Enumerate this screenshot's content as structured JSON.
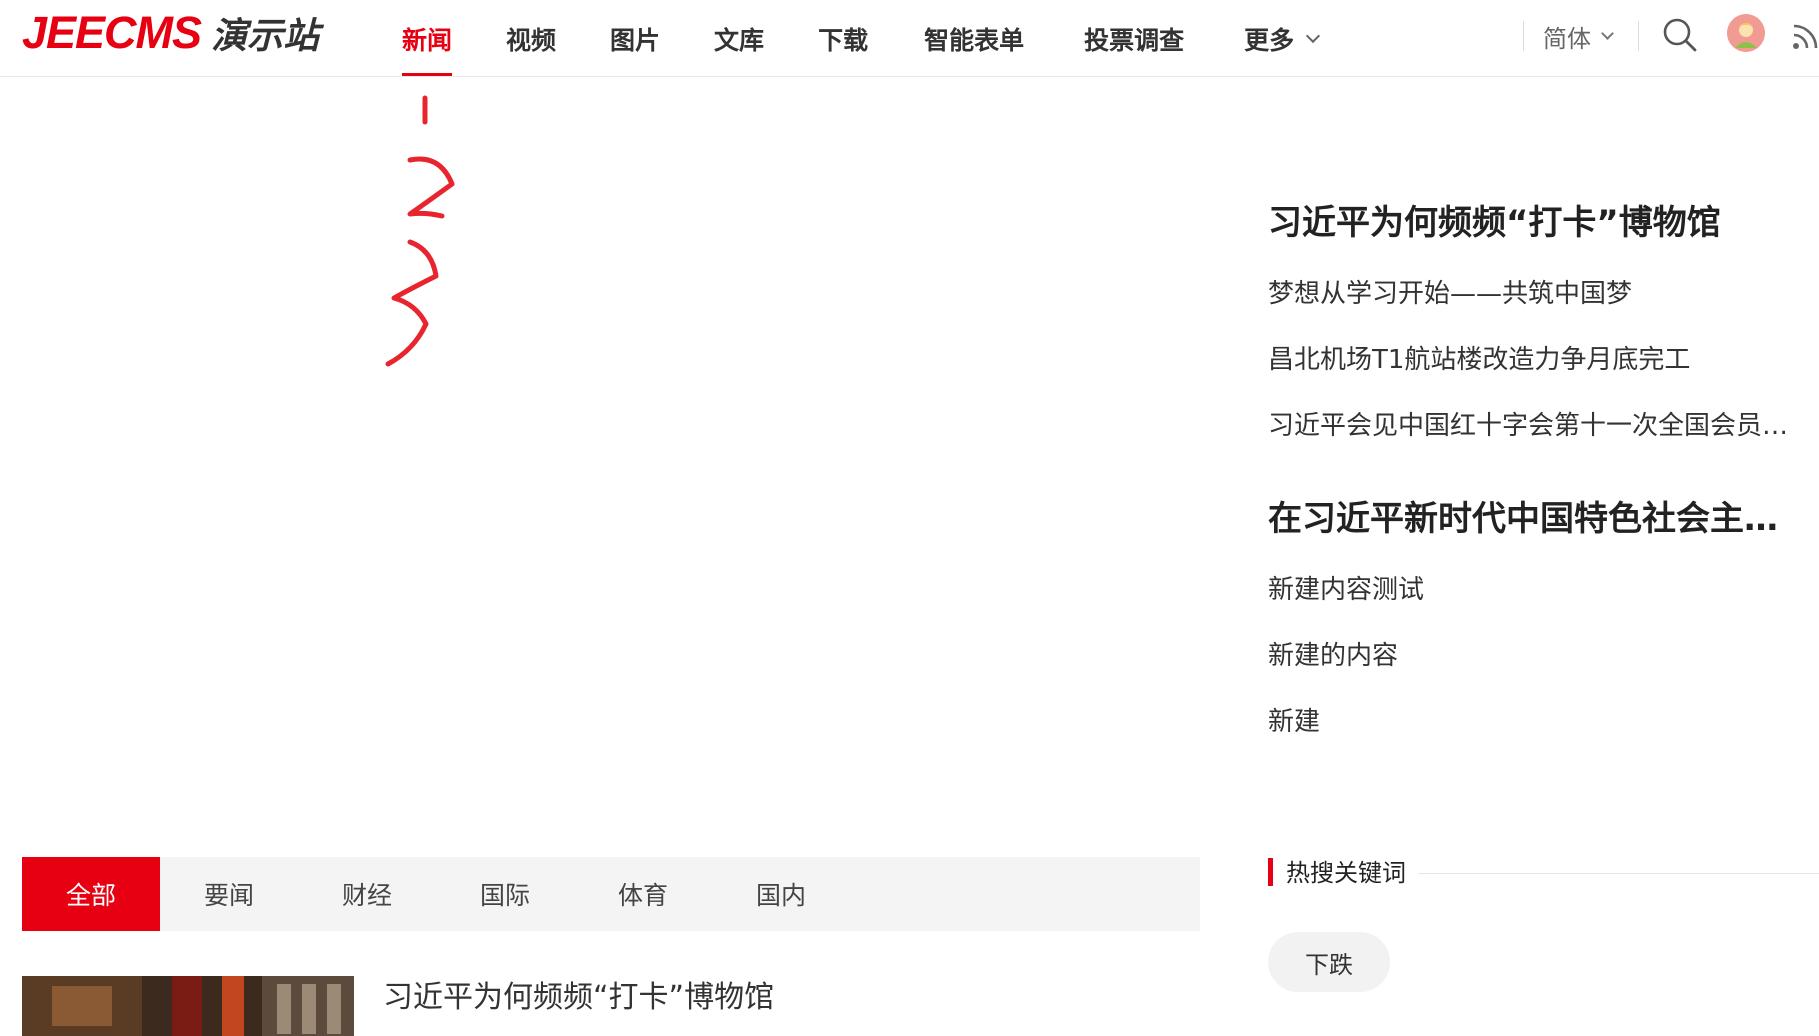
{
  "header": {
    "logo_brand": "JEECMS",
    "logo_sub": "演示站",
    "nav": [
      {
        "label": "新闻",
        "active": true
      },
      {
        "label": "视频",
        "active": false
      },
      {
        "label": "图片",
        "active": false
      },
      {
        "label": "文库",
        "active": false
      },
      {
        "label": "下载",
        "active": false
      },
      {
        "label": "智能表单",
        "active": false
      },
      {
        "label": "投票调查",
        "active": false
      },
      {
        "label": "更多",
        "active": false,
        "icon": "chevron-down-icon"
      }
    ],
    "language": "简体",
    "icons": [
      "search-icon",
      "avatar",
      "rss-icon"
    ],
    "accent_color": "#e60012"
  },
  "sidebar": {
    "groups": [
      {
        "headline": "习近平为何频频“打卡”博物馆",
        "links": [
          "梦想从学习开始——共筑中国梦",
          "昌北机场T1航站楼改造力争月底完工",
          "习近平会见中国红十字会第十一次全国会员代表大会代表"
        ]
      },
      {
        "headline": "在习近平新时代中国特色社会主义思想指引下",
        "links": [
          "新建内容测试",
          "新建的内容",
          "新建"
        ]
      }
    ],
    "hot_keywords_title": "热搜关键词",
    "hot_keywords": [
      "下跌"
    ]
  },
  "tabs": [
    {
      "label": "全部",
      "active": true
    },
    {
      "label": "要闻",
      "active": false
    },
    {
      "label": "财经",
      "active": false
    },
    {
      "label": "国际",
      "active": false
    },
    {
      "label": "体育",
      "active": false
    },
    {
      "label": "国内",
      "active": false
    }
  ],
  "news_list": [
    {
      "title": "习近平为何频频“打卡”博物馆"
    }
  ]
}
